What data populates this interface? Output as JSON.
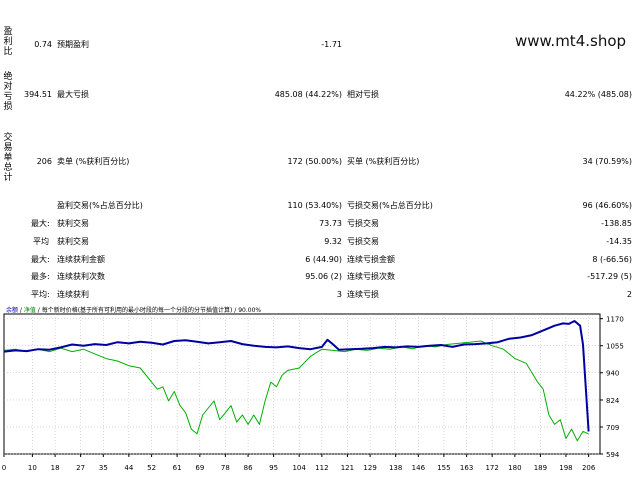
{
  "watermark": "www.mt4.shop",
  "section_labels": {
    "profit_factor": "盈利比",
    "absolute": "绝对亏损",
    "total_trades": "交易单总计"
  },
  "rows": {
    "row1": {
      "val": "0.74",
      "label": "预期盈利",
      "val2": "-1.71"
    },
    "row2": {
      "val": "394.51",
      "label": "最大亏损",
      "val2": "485.08 (44.22%)",
      "label3": "相对亏损",
      "val3": "44.22% (485.08)"
    },
    "row3": {
      "val": "206",
      "label": "卖单 (%获利百分比)",
      "val2": "172 (50.00%)",
      "label3": "买单 (%获利百分比)",
      "val3": "34 (70.59%)"
    },
    "row4": {
      "label": "盈利交易(%占总百分比)",
      "val2": "110 (53.40%)",
      "label3": "亏损交易(%占总百分比)",
      "val3": "96 (46.60%)"
    },
    "row5": {
      "prefix": "最大:",
      "label": "获利交易",
      "val2": "73.73",
      "label3": "亏损交易",
      "val3": "-138.85"
    },
    "row6": {
      "prefix": "平均",
      "label": "获利交易",
      "val2": "9.32",
      "label3": "亏损交易",
      "val3": "-14.35"
    },
    "row7": {
      "prefix": "最大:",
      "label": "连续获利金额",
      "val2": "6 (44.90)",
      "label3": "连续亏损金额",
      "val3": "8 (-66.56)"
    },
    "row8": {
      "prefix": "最多:",
      "label": "连续获利次数",
      "val2": "95.06 (2)",
      "label3": "连续亏损次数",
      "val3": "-517.29 (5)"
    },
    "row9": {
      "prefix": "平均:",
      "label": "连续获利",
      "val2": "3",
      "label3": "连续亏损",
      "val3": "2"
    }
  },
  "legend": {
    "balance": "余额",
    "sep": " / ",
    "equity": "净值",
    "rest": " / 每个新时价格(基于所有可利用的最小时段的每一个分段的分节插值计算) / 90.00%"
  },
  "chart_data": {
    "type": "line",
    "x_ticks": [
      "0",
      "10",
      "18",
      "27",
      "35",
      "44",
      "52",
      "61",
      "69",
      "78",
      "86",
      "95",
      "104",
      "112",
      "121",
      "129",
      "138",
      "146",
      "155",
      "163",
      "172",
      "180",
      "189",
      "198",
      "206"
    ],
    "y_ticks": [
      "1170",
      "1055",
      "940",
      "824",
      "709",
      "594"
    ],
    "ylim": [
      594,
      1190
    ],
    "xlim": [
      0,
      210
    ],
    "colors": {
      "balance": "#0000a0",
      "equity": "#00b000",
      "grid": "#b0b0b0"
    },
    "series": [
      {
        "key": "balance",
        "x": [
          0,
          4,
          8,
          12,
          16,
          20,
          24,
          28,
          32,
          36,
          40,
          44,
          48,
          52,
          56,
          60,
          64,
          68,
          72,
          76,
          80,
          84,
          88,
          92,
          96,
          100,
          104,
          108,
          112,
          114,
          116,
          118,
          122,
          126,
          130,
          134,
          138,
          142,
          146,
          150,
          154,
          158,
          162,
          166,
          170,
          174,
          178,
          182,
          186,
          190,
          194,
          197,
          199,
          201,
          203,
          204,
          206
        ],
        "values": [
          1030,
          1035,
          1032,
          1040,
          1038,
          1048,
          1060,
          1055,
          1062,
          1058,
          1070,
          1065,
          1072,
          1068,
          1060,
          1075,
          1078,
          1072,
          1065,
          1070,
          1075,
          1062,
          1055,
          1050,
          1048,
          1052,
          1045,
          1040,
          1050,
          1080,
          1060,
          1038,
          1040,
          1042,
          1045,
          1050,
          1048,
          1052,
          1050,
          1055,
          1058,
          1050,
          1060,
          1062,
          1065,
          1070,
          1085,
          1090,
          1100,
          1120,
          1140,
          1150,
          1148,
          1160,
          1140,
          1060,
          690
        ]
      },
      {
        "key": "equity",
        "x": [
          0,
          4,
          8,
          12,
          16,
          20,
          24,
          28,
          32,
          36,
          40,
          44,
          48,
          52,
          54,
          56,
          58,
          60,
          62,
          64,
          66,
          68,
          70,
          72,
          74,
          76,
          78,
          80,
          82,
          84,
          86,
          88,
          90,
          92,
          94,
          96,
          98,
          100,
          104,
          108,
          112,
          116,
          120,
          124,
          128,
          132,
          136,
          140,
          144,
          148,
          152,
          156,
          160,
          164,
          168,
          172,
          176,
          180,
          184,
          188,
          190,
          192,
          194,
          196,
          198,
          200,
          202,
          204,
          206
        ],
        "values": [
          1035,
          1040,
          1030,
          1040,
          1030,
          1045,
          1030,
          1040,
          1020,
          1000,
          990,
          970,
          960,
          900,
          870,
          880,
          820,
          860,
          800,
          770,
          700,
          680,
          760,
          790,
          820,
          740,
          770,
          800,
          730,
          760,
          720,
          760,
          720,
          820,
          900,
          880,
          930,
          950,
          960,
          1010,
          1040,
          1035,
          1030,
          1040,
          1035,
          1045,
          1040,
          1050,
          1042,
          1055,
          1050,
          1060,
          1065,
          1070,
          1075,
          1055,
          1040,
          1000,
          980,
          900,
          870,
          760,
          720,
          740,
          660,
          700,
          650,
          690,
          680
        ]
      }
    ]
  }
}
